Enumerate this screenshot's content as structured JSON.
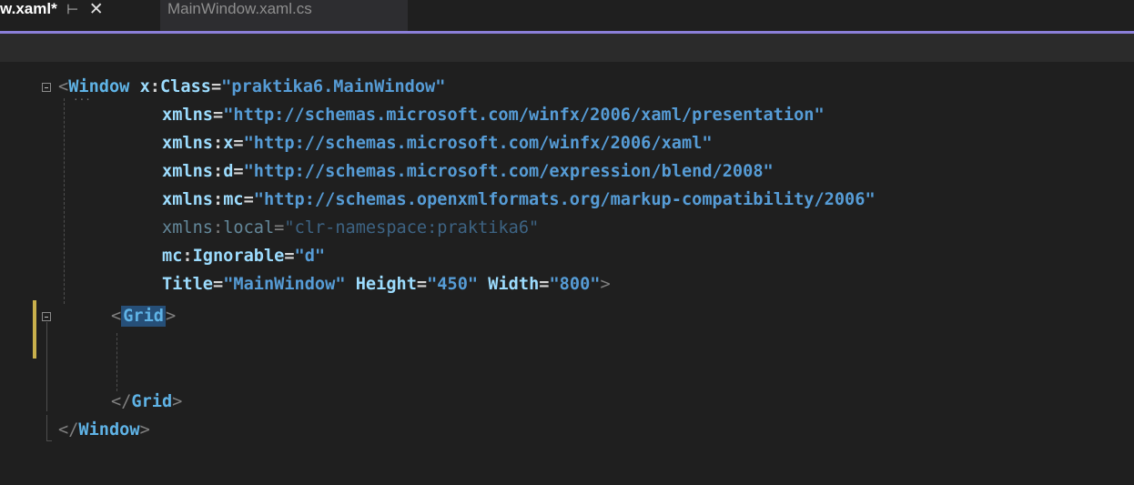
{
  "tabs": {
    "active": {
      "name": "w.xaml*"
    },
    "inactive": {
      "name": "MainWindow.xaml.cs"
    }
  },
  "icons": {
    "pin": "pin-icon",
    "close": "close-icon",
    "fold": "fold-collapse-icon"
  },
  "colors": {
    "accent": "#8b7fd9",
    "tag": "#5fb3e6",
    "attribute": "#9cdcfe",
    "string": "#569cd6",
    "selection": "#264f78",
    "change_marker": "#c9b04c"
  },
  "code": {
    "l1": {
      "tag": "Window",
      "attr_ns": "x",
      "attr": "Class",
      "value": "\"praktika6.MainWindow\""
    },
    "l2": {
      "attr": "xmlns",
      "value": "\"http://schemas.microsoft.com/winfx/2006/xaml/presentation\""
    },
    "l3": {
      "attr_ns": "xmlns",
      "attr": "x",
      "value": "\"http://schemas.microsoft.com/winfx/2006/xaml\""
    },
    "l4": {
      "attr_ns": "xmlns",
      "attr": "d",
      "value": "\"http://schemas.microsoft.com/expression/blend/2008\""
    },
    "l5": {
      "attr_ns": "xmlns",
      "attr": "mc",
      "value": "\"http://schemas.openxmlformats.org/markup-compatibility/2006\""
    },
    "l6": {
      "attr_ns": "xmlns",
      "attr": "local",
      "value": "\"clr-namespace:praktika6\""
    },
    "l7": {
      "attr_ns": "mc",
      "attr": "Ignorable",
      "value": "\"d\""
    },
    "l8": {
      "a1": "Title",
      "v1": "\"MainWindow\"",
      "a2": "Height",
      "v2": "\"450\"",
      "a3": "Width",
      "v3": "\"800\""
    },
    "l9": {
      "tag": "Grid"
    },
    "l12": {
      "tag": "Grid"
    },
    "l13": {
      "tag": "Window"
    }
  }
}
